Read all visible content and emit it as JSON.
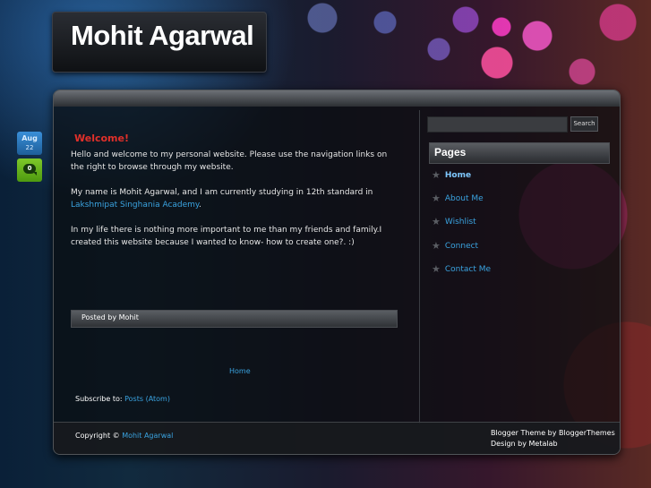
{
  "header": {
    "site_title": "Mohit Agarwal"
  },
  "post": {
    "date_month": "Aug",
    "date_day": "22",
    "comment_count": "0",
    "title": "Welcome!",
    "paragraph1": "Hello and welcome to my personal website. Please use the navigation links on the right to browse through my website.",
    "paragraph2_prefix": "My name is Mohit Agarwal, and I am currently studying in 12th standard in ",
    "paragraph2_link": "Lakshmipat Singhania Academy",
    "paragraph2_suffix": ".",
    "paragraph3": "In my life there is nothing more important to me than my friends and family.I created this website because I wanted to know- how to create one?. :)",
    "posted_by": "Posted by Mohit"
  },
  "blog_nav": {
    "home_label": "Home",
    "subscribe_prefix": "Subscribe to: ",
    "subscribe_link": "Posts (Atom)"
  },
  "sidebar": {
    "search_placeholder": "",
    "search_button": "Search",
    "pages_title": "Pages",
    "pages": [
      {
        "label": "Home",
        "active": true
      },
      {
        "label": "About Me",
        "active": false
      },
      {
        "label": "Wishlist",
        "active": false
      },
      {
        "label": "Connect",
        "active": false
      },
      {
        "label": "Contact Me",
        "active": false
      }
    ]
  },
  "footer": {
    "copyright_prefix": "Copyright © ",
    "copyright_link": "Mohit Agarwal",
    "credit_line1": "Blogger Theme by BloggerThemes",
    "credit_line2": "Design by Metalab"
  },
  "colors": {
    "link": "#3aa3e0",
    "post_title": "#e0302a",
    "date_badge": "#2b7bc0",
    "comment_badge": "#6ab820"
  }
}
